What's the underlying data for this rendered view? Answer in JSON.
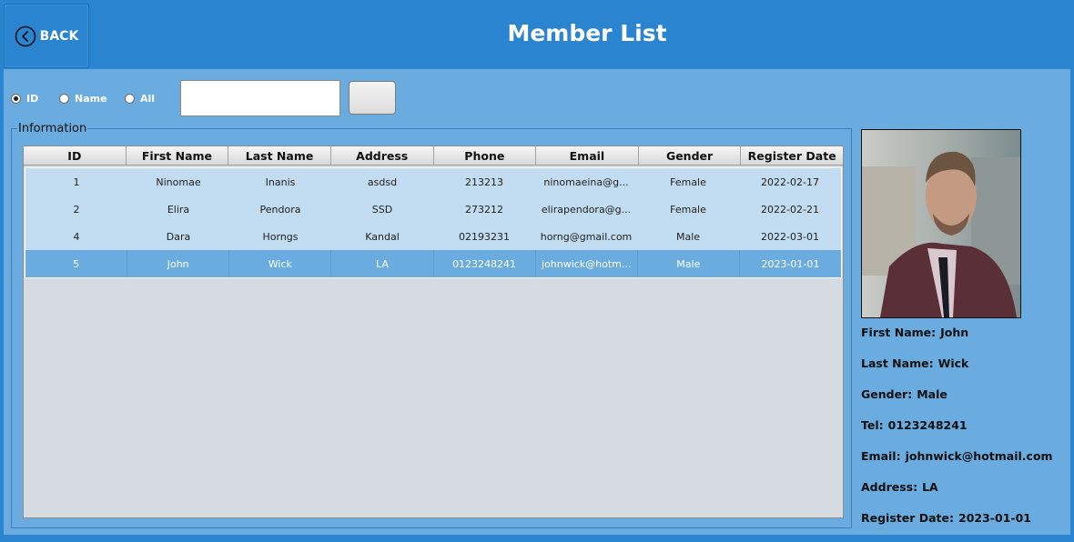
{
  "header": {
    "back_label": "BACK",
    "title": "Member List"
  },
  "search": {
    "options": [
      {
        "label": "ID",
        "checked": true
      },
      {
        "label": "Name",
        "checked": false
      },
      {
        "label": "All",
        "checked": false
      }
    ],
    "input_value": "",
    "button_label": ""
  },
  "info": {
    "group_label": "Information",
    "columns": [
      "ID",
      "First Name",
      "Last Name",
      "Address",
      "Phone",
      "Email",
      "Gender",
      "Register Date"
    ],
    "rows": [
      [
        "1",
        "Ninomae",
        "Inanis",
        "asdsd",
        "213213",
        "ninomaeina@g...",
        "Female",
        "2022-02-17"
      ],
      [
        "2",
        "Elira",
        "Pendora",
        "SSD",
        "273212",
        "elirapendora@g...",
        "Female",
        "2022-02-21"
      ],
      [
        "4",
        "Dara",
        "Horngs",
        "Kandal",
        "02193231",
        "horng@gmail.com",
        "Male",
        "2022-03-01"
      ],
      [
        "5",
        "John",
        "Wick",
        "LA",
        "0123248241",
        "johnwick@hotm...",
        "Male",
        "2023-01-01"
      ]
    ],
    "selected_row": 3
  },
  "details": {
    "first_name_label": "First Name:",
    "first_name": "John",
    "last_name_label": "Last Name:",
    "last_name": "Wick",
    "gender_label": "Gender:",
    "gender": "Male",
    "tel_label": "Tel:",
    "tel": "0123248241",
    "email_label": "Email:",
    "email": "johnwick@hotmail.com",
    "address_label": "Address:",
    "address": "LA",
    "register_label": "Register Date:",
    "register": "2023-01-01"
  },
  "colors": {
    "header_bg": "#2a84d0",
    "panel_bg": "#6aace0",
    "row_bg": "#c2dcf1",
    "row_selected_bg": "#6aace0",
    "table_bg": "#d6dae1"
  },
  "icons": {
    "back": "chevron-left-circle-icon"
  }
}
